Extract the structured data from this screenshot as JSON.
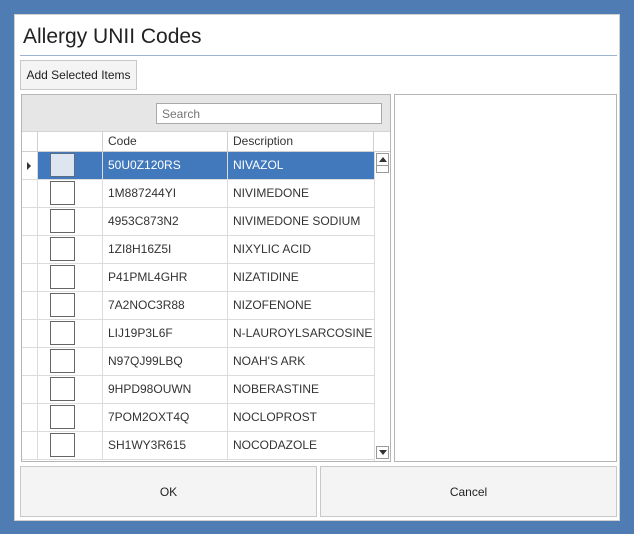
{
  "dialog": {
    "title": "Allergy UNII Codes",
    "add_selected_label": "Add Selected Items",
    "ok_label": "OK",
    "cancel_label": "Cancel"
  },
  "grid": {
    "search_placeholder": "Search",
    "columns": {
      "code": "Code",
      "description": "Description"
    },
    "selected_index": 0,
    "rows": [
      {
        "code": "50U0Z120RS",
        "description": "NIVAZOL"
      },
      {
        "code": "1M887244YI",
        "description": "NIVIMEDONE"
      },
      {
        "code": "4953C873N2",
        "description": "NIVIMEDONE SODIUM"
      },
      {
        "code": "1ZI8H16Z5I",
        "description": "NIXYLIC ACID"
      },
      {
        "code": "P41PML4GHR",
        "description": "NIZATIDINE"
      },
      {
        "code": "7A2NOC3R88",
        "description": "NIZOFENONE"
      },
      {
        "code": "LIJ19P3L6F",
        "description": "N-LAUROYLSARCOSINE"
      },
      {
        "code": "N97QJ99LBQ",
        "description": "NOAH'S ARK"
      },
      {
        "code": "9HPD98OUWN",
        "description": "NOBERASTINE"
      },
      {
        "code": "7POM2OXT4Q",
        "description": "NOCLOPROST"
      },
      {
        "code": "SH1WY3R615",
        "description": "NOCODAZOLE"
      }
    ]
  },
  "colors": {
    "window_background": "#4f7db3",
    "selection": "#4279bd"
  }
}
